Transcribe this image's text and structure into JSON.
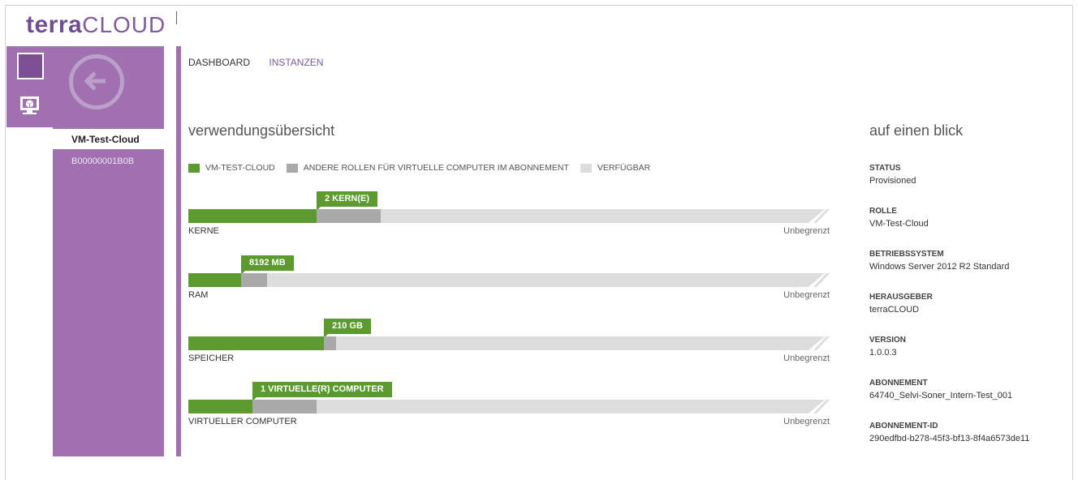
{
  "logo": {
    "bold": "terra",
    "light": "CLOUD"
  },
  "iconbar": {
    "items": [
      {
        "icon": "grid-icon"
      },
      {
        "icon": "virtual-machine-icon"
      }
    ]
  },
  "sidebar": {
    "selected": "VM-Test-Cloud",
    "sub": "B00000001B0B"
  },
  "nav": {
    "dashboard": "DASHBOARD",
    "instances": "INSTANZEN"
  },
  "usage": {
    "title": "verwendungsübersicht",
    "legend": [
      {
        "label": "VM-TEST-CLOUD",
        "color": "#5b9a2f"
      },
      {
        "label": "ANDERE ROLLEN FÜR VIRTUELLE COMPUTER IM ABONNEMENT",
        "color": "#a9a9a9"
      },
      {
        "label": "VERFÜGBAR",
        "color": "#dddddd"
      }
    ],
    "gauges": [
      {
        "label": "KERNE",
        "callout": "2 KERN(E)",
        "limit": "Unbegrenzt",
        "used_fraction": 0.2,
        "other_fraction": 0.1
      },
      {
        "label": "RAM",
        "callout": "8192 MB",
        "limit": "Unbegrenzt",
        "used_fraction": 0.082,
        "other_fraction": 0.041
      },
      {
        "label": "SPEICHER",
        "callout": "210 GB",
        "limit": "Unbegrenzt",
        "used_fraction": 0.211,
        "other_fraction": 0.019
      },
      {
        "label": "VIRTUELLER COMPUTER",
        "callout": "1 VIRTUELLE(R) COMPUTER",
        "limit": "Unbegrenzt",
        "used_fraction": 0.1,
        "other_fraction": 0.1
      }
    ]
  },
  "glance": {
    "title": "auf einen blick",
    "items": [
      {
        "key": "STATUS",
        "value": "Provisioned"
      },
      {
        "key": "ROLLE",
        "value": "VM-Test-Cloud"
      },
      {
        "key": "BETRIEBSSYSTEM",
        "value": "Windows Server 2012 R2 Standard"
      },
      {
        "key": "HERAUSGEBER",
        "value": "terraCLOUD"
      },
      {
        "key": "VERSION",
        "value": "1.0.0.3"
      },
      {
        "key": "ABONNEMENT",
        "value": "64740_Selvi-Soner_Intern-Test_001"
      },
      {
        "key": "ABONNEMENT-ID",
        "value": "290edfbd-b278-45f3-bf13-8f4a6573de11"
      }
    ]
  }
}
